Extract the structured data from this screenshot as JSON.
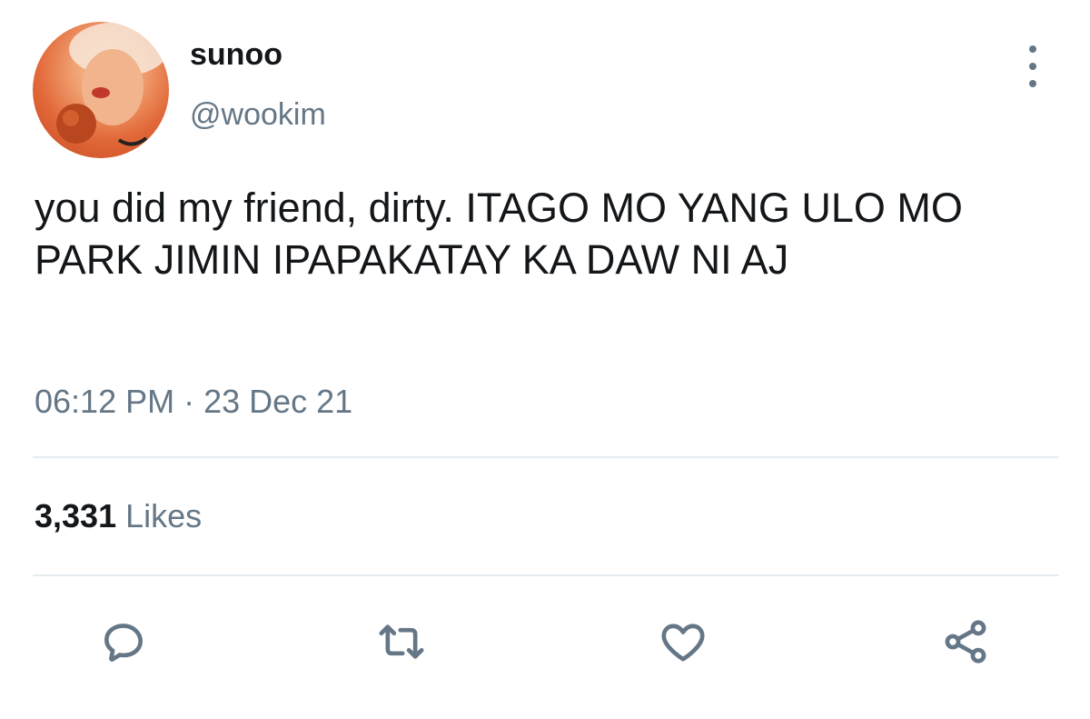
{
  "user": {
    "display_name": "sunoo",
    "handle": "@wookim",
    "avatar_icon": "profile-photo"
  },
  "tweet": {
    "text": "you did my friend, dirty. ITAGO MO YANG ULO MO PARK JIMIN IPAPAKATAY KA DAW NI AJ",
    "timestamp": "06:12 PM · 23 Dec 21"
  },
  "stats": {
    "likes_count": "3,331",
    "likes_label": "Likes"
  },
  "actions": {
    "reply_icon": "comment-icon",
    "retweet_icon": "retweet-icon",
    "like_icon": "heart-icon",
    "share_icon": "share-icon",
    "more_icon": "more-vertical-icon"
  },
  "colors": {
    "text_primary": "#14171a",
    "text_secondary": "#657786",
    "divider": "#e6ecf0"
  }
}
